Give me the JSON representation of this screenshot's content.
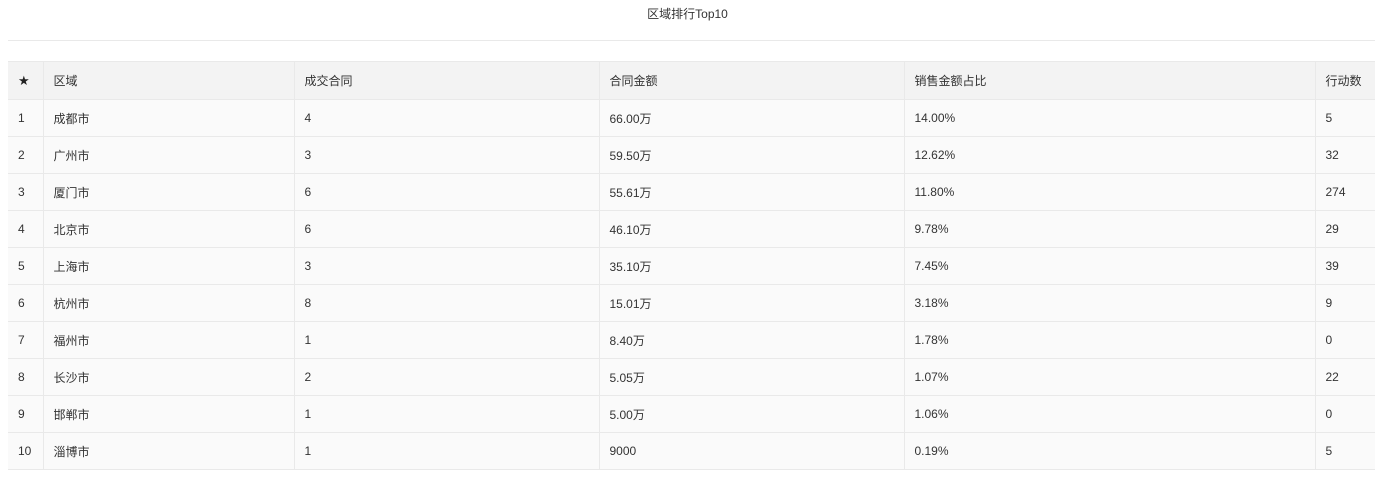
{
  "title": "区域排行Top10",
  "table": {
    "headers": {
      "star_icon": "star-icon",
      "region": "区域",
      "deals": "成交合同",
      "amount": "合同金额",
      "share": "销售金额占比",
      "actions": "行动数"
    },
    "rows": [
      {
        "rank": "1",
        "region": "成都市",
        "deals": "4",
        "amount": "66.00万",
        "share": "14.00%",
        "actions": "5"
      },
      {
        "rank": "2",
        "region": "广州市",
        "deals": "3",
        "amount": "59.50万",
        "share": "12.62%",
        "actions": "32"
      },
      {
        "rank": "3",
        "region": "厦门市",
        "deals": "6",
        "amount": "55.61万",
        "share": "11.80%",
        "actions": "274"
      },
      {
        "rank": "4",
        "region": "北京市",
        "deals": "6",
        "amount": "46.10万",
        "share": "9.78%",
        "actions": "29"
      },
      {
        "rank": "5",
        "region": "上海市",
        "deals": "3",
        "amount": "35.10万",
        "share": "7.45%",
        "actions": "39"
      },
      {
        "rank": "6",
        "region": "杭州市",
        "deals": "8",
        "amount": "15.01万",
        "share": "3.18%",
        "actions": "9"
      },
      {
        "rank": "7",
        "region": "福州市",
        "deals": "1",
        "amount": "8.40万",
        "share": "1.78%",
        "actions": "0"
      },
      {
        "rank": "8",
        "region": "长沙市",
        "deals": "2",
        "amount": "5.05万",
        "share": "1.07%",
        "actions": "22"
      },
      {
        "rank": "9",
        "region": "邯郸市",
        "deals": "1",
        "amount": "5.00万",
        "share": "1.06%",
        "actions": "0"
      },
      {
        "rank": "10",
        "region": "淄博市",
        "deals": "1",
        "amount": "9000",
        "share": "0.19%",
        "actions": "5"
      }
    ]
  }
}
